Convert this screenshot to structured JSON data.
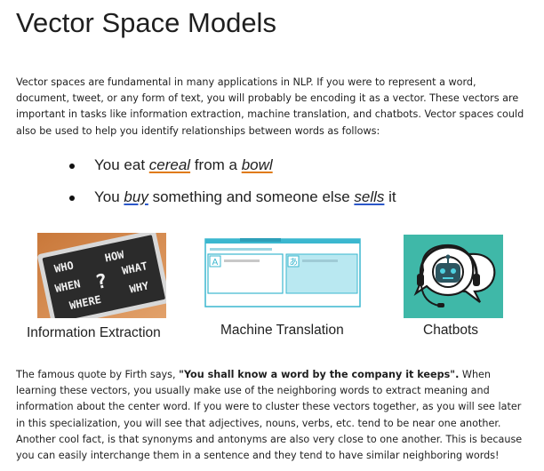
{
  "title": "Vector Space Models",
  "intro": "Vector spaces are fundamental in many applications in NLP. If you were to represent a word, document, tweet, or any form of text, you will probably be encoding it as a vector. These vectors are important in tasks like information extraction, machine translation, and chatbots. Vector spaces could also be used to help you identify relationships between words as follows:",
  "bullets": [
    {
      "before": "You eat ",
      "w1": "cereal",
      "mid": " from a ",
      "w2": "bowl",
      "after": ""
    },
    {
      "before": "You ",
      "w1": "buy",
      "mid": " something and someone else ",
      "w2": "sells",
      "after": " it"
    }
  ],
  "figures": {
    "ie": {
      "caption": "Information Extraction",
      "chalk_words": [
        "WHO",
        "HOW",
        "WHAT",
        "WHEN",
        "?",
        "WHY",
        "WHERE"
      ]
    },
    "mt": {
      "caption": "Machine Translation",
      "left_glyph": "A",
      "right_glyph": "あ"
    },
    "cb": {
      "caption": "Chatbots"
    }
  },
  "closing": {
    "before": "The famous quote by Firth says, ",
    "quote": "\"You shall know a word by the company it keeps\".",
    "after": " When learning these vectors, you usually make use of the neighboring words to extract meaning and information about the center word. If you were to cluster these vectors together, as you will see later in this specialization, you will see that adjectives, nouns, verbs, etc. tend to be near one another. Another cool fact, is that synonyms and antonyms are also very close to one another. This is because you can easily interchange them in a sentence and they tend to have similar neighboring words!"
  },
  "colors": {
    "underline_orange": "#e07a12",
    "underline_blue": "#2b57c9",
    "chatbot_bg": "#3fb8a8",
    "mt_accent": "#3bb7cf"
  }
}
